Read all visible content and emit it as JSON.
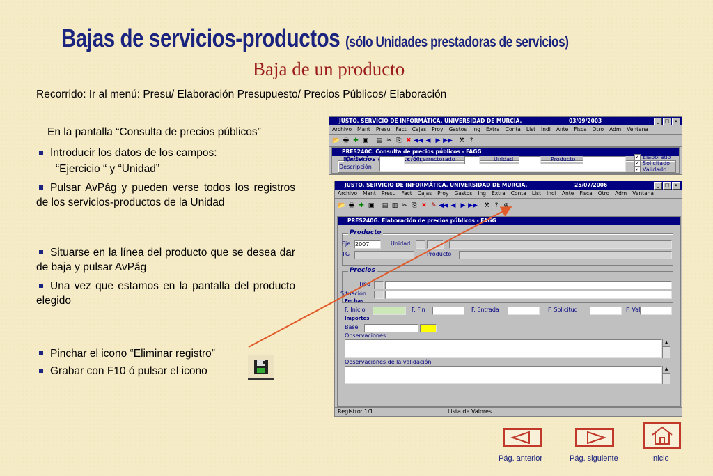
{
  "title": {
    "main": "Bajas de servicios-productos",
    "note": "(sólo Unidades prestadoras de servicios)"
  },
  "subtitle": "Baja de un producto",
  "recorrido": "Recorrido:  Ir al menú: Presu/ Elaboración Presupuesto/ Precios Públicos/ Elaboración",
  "intro": "En la pantalla “Consulta de precios públicos”",
  "bullets": [
    "Introducir los datos de los campos:",
    "Pulsar AvPág y pueden verse todos los registros de los servicios-productos de la Unidad",
    "Situarse en la línea del producto que se desea dar de baja y pulsar AvPág",
    "Una vez que estamos en la pantalla del producto elegido",
    "Pinchar el icono “Eliminar registro”",
    "Grabar con F10 ó pulsar el icono"
  ],
  "fields_line": "“Ejercicio “ y “Unidad”",
  "screen1": {
    "title": "JUSTO. SERVICIO DE INFORMÁTICA. UNIVERSIDAD DE MURCIA.",
    "date": "03/09/2003",
    "menu": [
      "Archivo",
      "Mant",
      "Presu",
      "Fact",
      "Cajas",
      "Proy",
      "Gastos",
      "Ing",
      "Extra",
      "Conta",
      "List",
      "Indi",
      "Ante",
      "Fisca",
      "Otro",
      "Adm",
      "Ventana"
    ],
    "inner_title": "PRES240C. Consulta de precios públicos - FAGG",
    "group": "Criterios de selección",
    "labels": {
      "ejercicio": "Ejercicio",
      "vicerrectorado": "Vicerrectorado",
      "unidad": "Unidad",
      "producto": "Producto",
      "descripcion": "Descripción"
    },
    "checks": [
      "Elaborado",
      "Solicitado",
      "Validado"
    ]
  },
  "screen2": {
    "title": "JUSTO. SERVICIO DE INFORMÁTICA. UNIVERSIDAD DE MURCIA.",
    "date": "25/07/2006",
    "menu": [
      "Archivo",
      "Mant",
      "Presu",
      "Fact",
      "Cajas",
      "Proy",
      "Gastos",
      "Ing",
      "Extra",
      "Conta",
      "List",
      "Indi",
      "Ante",
      "Fisca",
      "Otro",
      "Adm",
      "Ventana"
    ],
    "inner_title": "PRES240G. Elaboración de precios públicos - FAGG",
    "producto_group": "Producto",
    "labels": {
      "eje": "Eje",
      "unidad": "Unidad",
      "tg": "TG",
      "producto": "Producto"
    },
    "ejercicio_value": "2007",
    "precios_group": "Precios",
    "tipo": "Tipo",
    "situacion": "Situación",
    "fechas": "Fechas",
    "f_inicio": "F. Inicio",
    "f_fin": "F. Fin",
    "f_entrada": "F. Entrada",
    "f_solicitud": "F. Solicitud",
    "f_val": "F. Val.",
    "importes": "Importes",
    "base": "Base",
    "observaciones": "Observaciones",
    "obs_validacion": "Observaciones de la validación",
    "status_registro": "Registro: 1/1",
    "status_lista": "Lista de Valores"
  },
  "nav": {
    "prev": "Pág. anterior",
    "next": "Pág. siguiente",
    "home": "Inicio"
  },
  "colors": {
    "title": "#1a237e",
    "subtitle": "#9b1c1c",
    "arrow": "#e05a2a",
    "win_title": "#000080",
    "background": "#f6ebc7"
  }
}
